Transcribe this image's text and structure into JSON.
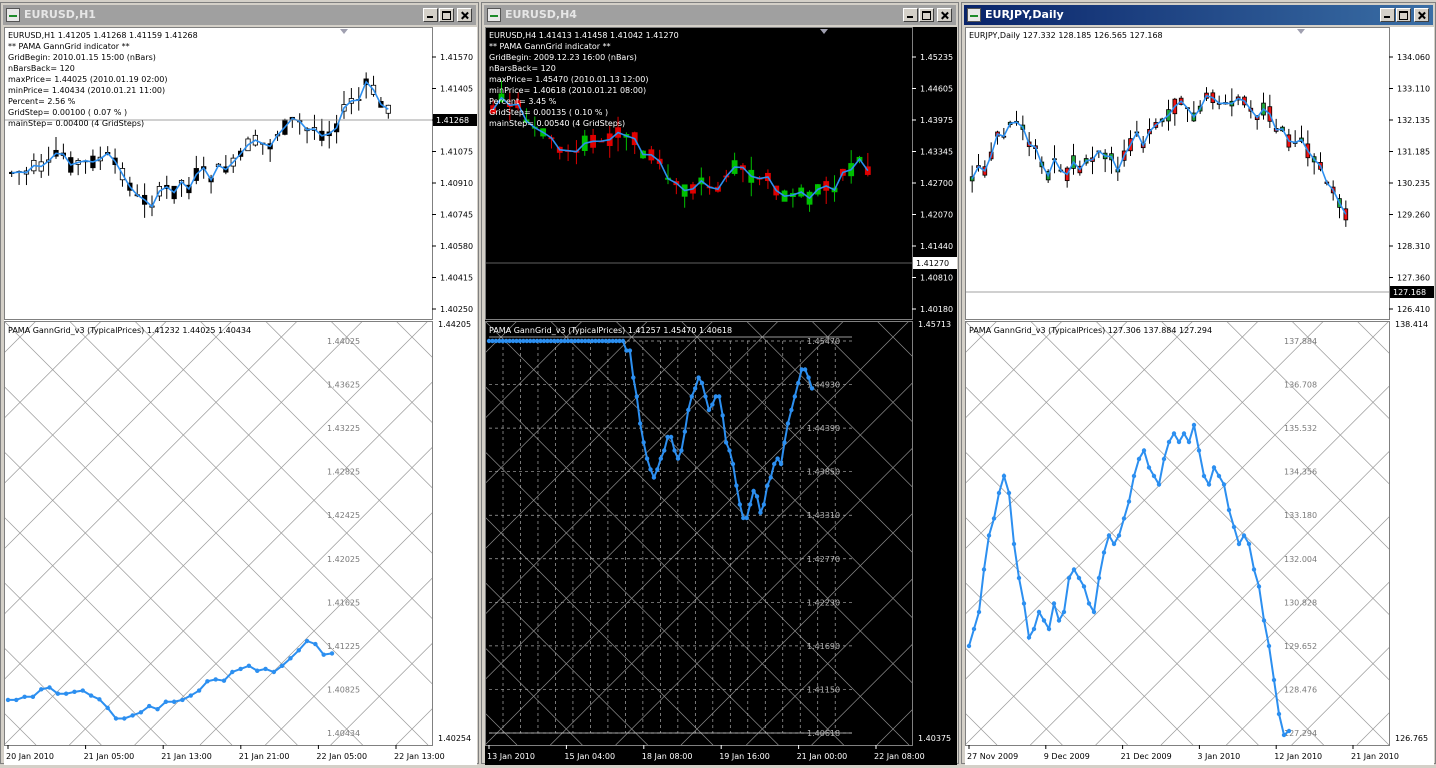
{
  "windows": [
    {
      "title": "EURUSD,H1",
      "active": false,
      "dark": false,
      "header": "EURUSD,H1  1.41205 1.41268 1.41159 1.41268",
      "info": [
        "** PAMA GannGrid indicator **",
        "GridBegin: 2010.01.15 15:00  (nBars)",
        "nBarsBack= 120",
        "maxPrice= 1.44025  (2010.01.19 02:00)",
        "minPrice= 1.40434  (2010.01.21 11:00)",
        "Percent= 2.56 %",
        "GridStep= 0.00100 ( 0.07 % )",
        "mainStep= 0.00400 (4 GridSteps)"
      ],
      "price_axis": [
        "1.41570",
        "1.41405",
        "1.41240",
        "1.41075",
        "1.40910",
        "1.40745",
        "1.40580",
        "1.40415",
        "1.40250"
      ],
      "current_price": "1.41268",
      "indicator_header": "PAMA GannGrid_v3  (TypicalPrices)  1.41232 1.44025 1.40434",
      "ind_axis_top": "1.44205",
      "ind_axis_bottom": "1.40254",
      "grid_levels": [
        "1.44025",
        "1.43625",
        "1.43225",
        "1.42825",
        "1.42425",
        "1.42025",
        "1.41625",
        "1.41225",
        "1.40825",
        "1.40434"
      ],
      "time_axis": [
        "20 Jan 2010",
        "21 Jan 05:00",
        "21 Jan 13:00",
        "21 Jan 21:00",
        "22 Jan 05:00",
        "22 Jan 13:00"
      ]
    },
    {
      "title": "EURUSD,H4",
      "active": false,
      "dark": true,
      "header": "EURUSD,H4  1.41413 1.41458 1.41042 1.41270",
      "info": [
        "** PAMA GannGrid indicator **",
        "GridBegin: 2009.12.23 16:00  (nBars)",
        "nBarsBack= 120",
        "maxPrice= 1.45470  (2010.01.13 12:00)",
        "minPrice= 1.40618  (2010.01.21 08:00)",
        "Percent= 3.45 %",
        "GridStep= 0.00135 ( 0.10 % )",
        "mainStep= 0.00540 (4 GridSteps)"
      ],
      "price_axis": [
        "1.45235",
        "1.44605",
        "1.43975",
        "1.43345",
        "1.42700",
        "1.42070",
        "1.41440",
        "1.40810",
        "1.40180"
      ],
      "current_price": "1.41270",
      "indicator_header": "PAMA GannGrid_v3  (TypicalPrices)  1.41257 1.45470 1.40618",
      "ind_axis_top": "1.45713",
      "ind_axis_bottom": "1.40375",
      "grid_levels": [
        "1.45470",
        "1.44930",
        "1.44390",
        "1.43850",
        "1.43310",
        "1.42770",
        "1.42230",
        "1.41690",
        "1.41150",
        "1.40618"
      ],
      "time_axis": [
        "13 Jan 2010",
        "15 Jan 04:00",
        "18 Jan 08:00",
        "19 Jan 16:00",
        "21 Jan 00:00",
        "22 Jan 08:00"
      ]
    },
    {
      "title": "EURJPY,Daily",
      "active": true,
      "dark": false,
      "header": "EURJPY,Daily  127.332 128.185 126.565 127.168",
      "info": [],
      "price_axis": [
        "134.060",
        "133.110",
        "132.135",
        "131.185",
        "130.235",
        "129.260",
        "128.310",
        "127.360",
        "126.410"
      ],
      "current_price": "127.168",
      "indicator_header": "PAMA GannGrid_v3  (TypicalPrices)  127.306 137.884 127.294",
      "ind_axis_top": "138.414",
      "ind_axis_bottom": "126.765",
      "grid_levels": [
        "137.884",
        "136.708",
        "135.532",
        "134.356",
        "133.180",
        "132.004",
        "130.828",
        "129.652",
        "128.476",
        "127.294"
      ],
      "time_axis": [
        "27 Nov 2009",
        "9 Dec 2009",
        "21 Dec 2009",
        "3 Jan 2010",
        "12 Jan 2010",
        "21 Jan 2010"
      ]
    }
  ],
  "colors": {
    "line": "#2c8ff0",
    "bull_dark": "#00c000",
    "bear_dark": "#e00000",
    "bull_jpy": "#1fa33a",
    "bear_jpy": "#ee1111",
    "grid_light": "#9a9a9a",
    "grid_dark": "#8c8c8c"
  },
  "series": [
    [
      0.05,
      0.05,
      0.1,
      0.1,
      0.22,
      0.25,
      0.15,
      0.15,
      0.18,
      0.2,
      0.12,
      0.06,
      -0.08,
      -0.25,
      -0.25,
      -0.2,
      -0.15,
      -0.05,
      -0.1,
      0.02,
      0.02,
      0.05,
      0.12,
      0.2,
      0.35,
      0.38,
      0.36,
      0.5,
      0.55,
      0.6,
      0.52,
      0.55,
      0.5,
      0.6,
      0.72,
      0.85,
      1.0,
      0.95,
      0.78,
      0.8
    ],
    [
      0.75,
      0.95,
      1.0,
      0.85,
      0.78,
      0.8,
      0.85,
      0.72,
      0.62,
      0.6,
      0.55,
      0.48,
      0.42,
      0.36,
      0.34,
      0.32,
      0.3,
      0.3,
      0.25,
      0.25,
      0.28,
      0.32,
      0.35,
      0.35,
      0.38,
      0.38,
      0.4,
      0.4,
      0.38,
      0.42,
      0.42,
      0.45,
      0.45,
      0.45,
      0.46,
      0.43,
      0.32,
      0.2,
      0.18,
      0.2,
      0.12,
      0.12,
      0.02,
      -0.05,
      -0.15,
      -0.22,
      -0.28,
      -0.32,
      -0.35,
      -0.32,
      -0.28,
      -0.25,
      -0.2,
      -0.2,
      -0.25,
      -0.28,
      -0.25,
      -0.18,
      -0.1,
      -0.05,
      -0.02,
      0.02,
      0.0,
      -0.05,
      -0.1,
      -0.08,
      -0.05,
      -0.05,
      -0.12,
      -0.22,
      -0.25,
      -0.3,
      -0.38,
      -0.45,
      -0.5,
      -0.5,
      -0.45,
      -0.4,
      -0.42,
      -0.48,
      -0.45,
      -0.38,
      -0.35,
      -0.3,
      -0.28,
      -0.3,
      -0.22,
      -0.15,
      -0.1,
      -0.05,
      0.0,
      0.05,
      0.05,
      0.02,
      -0.02
    ],
    [
      0.1,
      0.2,
      0.3,
      0.55,
      0.75,
      0.85,
      1.0,
      1.1,
      1.0,
      0.7,
      0.5,
      0.35,
      0.15,
      0.2,
      0.3,
      0.25,
      0.2,
      0.35,
      0.25,
      0.3,
      0.5,
      0.55,
      0.5,
      0.45,
      0.35,
      0.3,
      0.5,
      0.65,
      0.75,
      0.7,
      0.75,
      0.85,
      0.95,
      1.1,
      1.2,
      1.25,
      1.15,
      1.1,
      1.05,
      1.2,
      1.3,
      1.35,
      1.3,
      1.35,
      1.3,
      1.4,
      1.25,
      1.1,
      1.05,
      1.15,
      1.1,
      1.05,
      0.9,
      0.8,
      0.7,
      0.75,
      0.7,
      0.55,
      0.45,
      0.25,
      0.1,
      -0.1,
      -0.3,
      -0.5,
      -0.4
    ]
  ]
}
